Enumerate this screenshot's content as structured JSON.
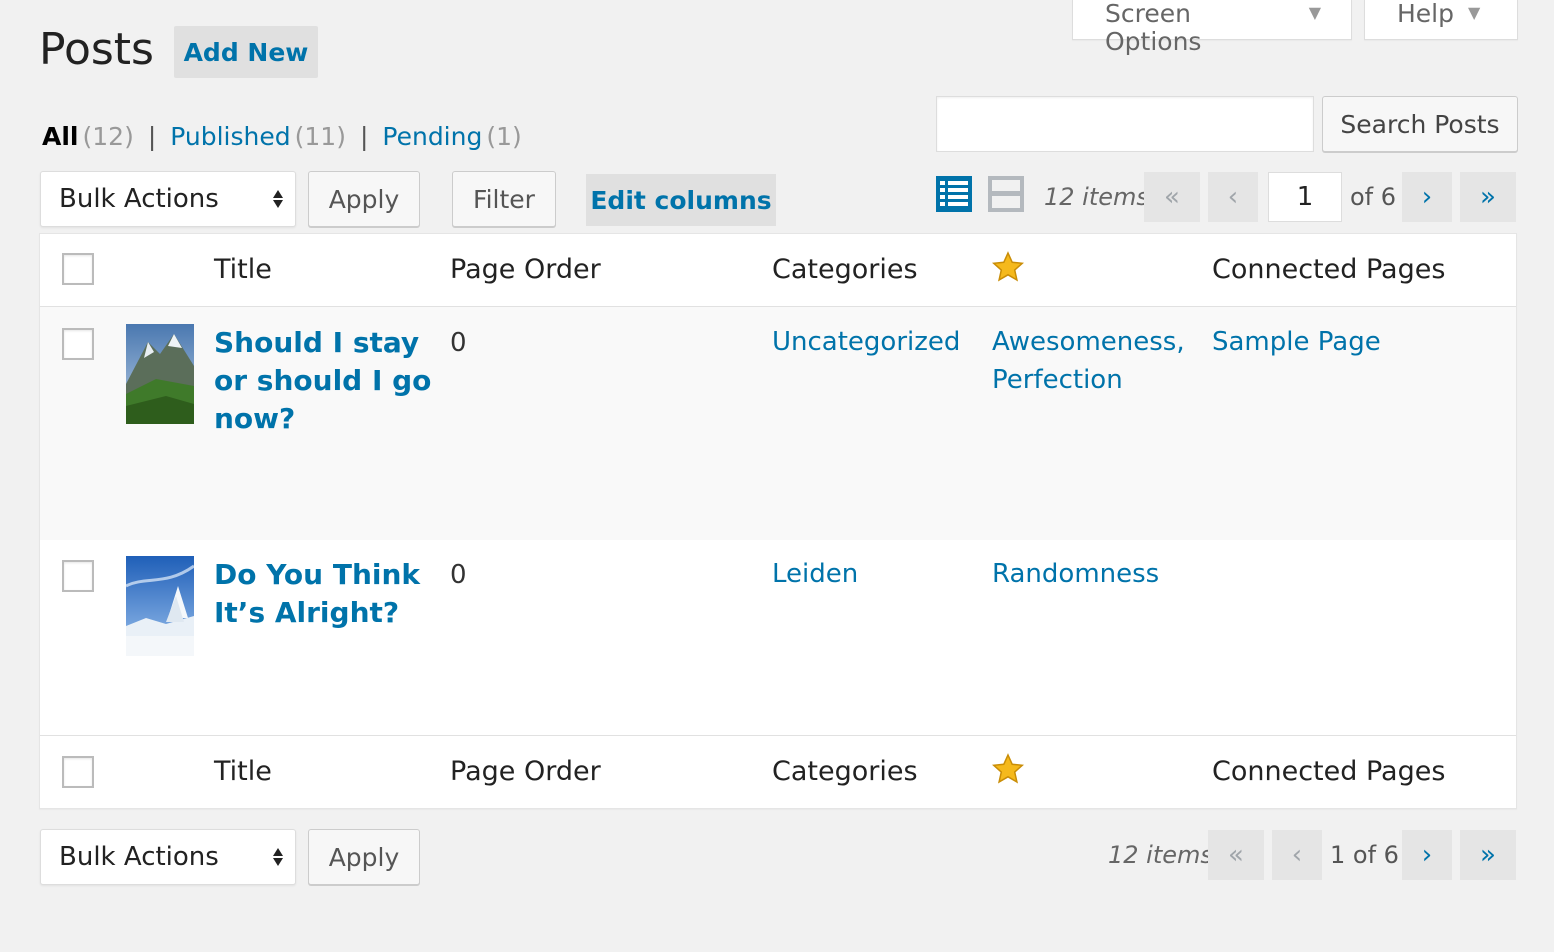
{
  "screen_meta": {
    "screen_options_label": "Screen Options",
    "help_label": "Help"
  },
  "header": {
    "title": "Posts",
    "add_new_label": "Add New"
  },
  "views": [
    {
      "label": "All",
      "count": "(12)",
      "current": true
    },
    {
      "label": "Published",
      "count": "(11)",
      "current": false
    },
    {
      "label": "Pending",
      "count": "(1)",
      "current": false
    }
  ],
  "search": {
    "value": "",
    "button_label": "Search Posts"
  },
  "tablenav_top": {
    "bulk_actions_label": "Bulk Actions",
    "apply_label": "Apply",
    "filter_label": "Filter",
    "edit_columns_label": "Edit columns",
    "items_count": "12 items",
    "first_label": "«",
    "prev_label": "‹",
    "current_page": "1",
    "total_pages_text": "of 6",
    "next_label": "›",
    "last_label": "»"
  },
  "tablenav_bottom": {
    "bulk_actions_label": "Bulk Actions",
    "apply_label": "Apply",
    "items_count": "12 items",
    "first_label": "«",
    "prev_label": "‹",
    "page_text": "1 of 6",
    "next_label": "›",
    "last_label": "»"
  },
  "columns": {
    "title": "Title",
    "page_order": "Page Order",
    "categories": "Categories",
    "rating_icon": "star-icon",
    "connected_pages": "Connected Pages"
  },
  "rows": [
    {
      "title_lines": [
        "Should I stay",
        "or should I go",
        "now?"
      ],
      "page_order": "0",
      "categories": "Uncategorized",
      "tags": [
        "Awesomeness,",
        "Perfection"
      ],
      "connected_pages": "Sample Page",
      "thumbnail_icon": "mountain-landscape-thumbnail"
    },
    {
      "title_lines": [
        "Do You Think",
        "It’s Alright?"
      ],
      "page_order": "0",
      "categories": "Leiden",
      "tags": [
        "Randomness"
      ],
      "connected_pages": "",
      "thumbnail_icon": "snowy-tree-thumbnail"
    }
  ],
  "colors": {
    "link": "#0073aa",
    "background": "#f1f1f1",
    "star": "#f5b91c"
  }
}
